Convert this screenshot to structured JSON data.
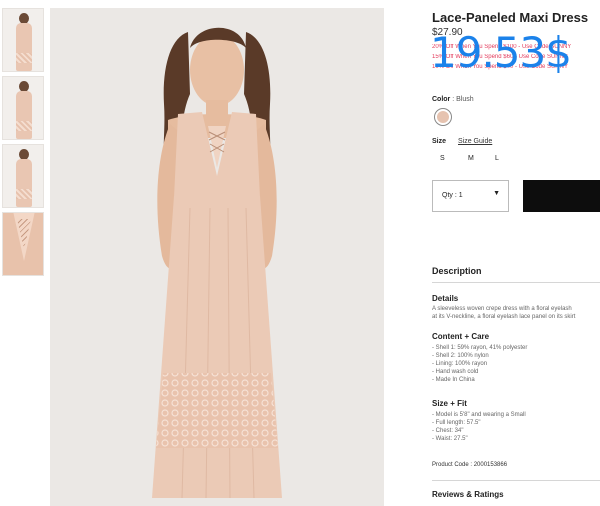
{
  "product": {
    "title": "Lace-Paneled Maxi Dress",
    "original_price": "$27.90",
    "overlay_price": "19.53$",
    "promos": [
      "20% Off When You Spend $100 - Use Code SUNNY",
      "15% Off When You Spend $60 - Use Code SUNNY",
      "10% Off When You Spend $40 - Use Code SUNNY"
    ]
  },
  "color": {
    "label": "Color",
    "value": ": Blush",
    "swatch": "#e6c3b0"
  },
  "size": {
    "label": "Size",
    "guide": "Size Guide",
    "options": [
      "S",
      "M",
      "L"
    ]
  },
  "cart": {
    "qty_label": "Qty : 1",
    "caret": "▼"
  },
  "description": {
    "heading": "Description",
    "details_heading": "Details",
    "details_lines": [
      "A sleeveless woven crepe dress with a floral eyelash",
      "at its V-neckline, a floral eyelash lace panel on its skirt"
    ],
    "content_heading": "Content + Care",
    "content_items": [
      "- Shell 1: 59% rayon, 41% polyester",
      "- Shell 2: 100% nylon",
      "- Lining: 100% rayon",
      "- Hand wash cold",
      "- Made In China"
    ],
    "fit_heading": "Size + Fit",
    "fit_items": [
      "- Model is 5'8\" and wearing a Small",
      "- Full length: 57.5\"",
      "- Chest: 34\"",
      "- Waist: 27.5\""
    ],
    "product_code": "Product Code : 2000153866"
  },
  "reviews": {
    "heading": "Reviews & Ratings"
  },
  "colors": {
    "sale_overlay": "#1b82ea",
    "promo": "#e33b5c",
    "dress": "#e9c6b2",
    "button": "#0d0d0d"
  }
}
